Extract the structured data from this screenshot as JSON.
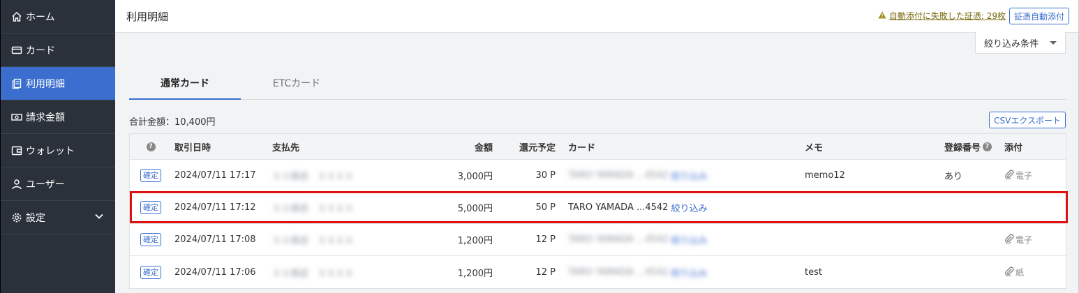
{
  "sidebar": {
    "items": [
      {
        "label": "ホーム",
        "icon": "home-icon"
      },
      {
        "label": "カード",
        "icon": "card-icon"
      },
      {
        "label": "利用明細",
        "icon": "statement-icon",
        "active": true
      },
      {
        "label": "請求金額",
        "icon": "money-icon"
      },
      {
        "label": "ウォレット",
        "icon": "wallet-icon"
      },
      {
        "label": "ユーザー",
        "icon": "user-icon"
      },
      {
        "label": "設定",
        "icon": "gear-icon"
      }
    ]
  },
  "header": {
    "title": "利用明細",
    "warning_link": "自動添付に失敗した証憑: 29枚",
    "auto_attach_label": "証憑自動添付"
  },
  "filter": {
    "label": "絞り込み条件"
  },
  "tabs": [
    {
      "label": "通常カード",
      "active": true
    },
    {
      "label": "ETCカード",
      "active": false
    }
  ],
  "summary": {
    "total": "合計金額：10,400円"
  },
  "csv_label": "CSVエクスポート",
  "table": {
    "headers": {
      "date": "取引日時",
      "payee": "支払先",
      "amount": "金額",
      "points": "還元予定",
      "card": "カード",
      "memo": "メモ",
      "reg": "登録番号",
      "attach": "添付"
    },
    "rows": [
      {
        "status": "確定",
        "date": "2024/07/11 17:17",
        "payee": "ＸＸ商店　ＸＸＸＸ",
        "amount": "3,000円",
        "points": "30 P",
        "card": "TARO YAMADA ...4542",
        "card_link": "絞り込み",
        "card_blurred": true,
        "memo": "memo12",
        "reg": "あり",
        "attach": "電子"
      },
      {
        "status": "確定",
        "date": "2024/07/11 17:12",
        "payee": "ＸＸ商店　ＸＸＸＸ",
        "amount": "5,000円",
        "points": "50 P",
        "card": "TARO YAMADA ...4542",
        "card_link": "絞り込み",
        "card_blurred": false,
        "memo": "",
        "reg": "",
        "attach": ""
      },
      {
        "status": "確定",
        "date": "2024/07/11 17:08",
        "payee": "ＸＸ商店　ＸＸＸＸ",
        "amount": "1,200円",
        "points": "12 P",
        "card": "TARO YAMADA ...4542",
        "card_link": "絞り込み",
        "card_blurred": true,
        "memo": "",
        "reg": "",
        "attach": "電子"
      },
      {
        "status": "確定",
        "date": "2024/07/11 17:06",
        "payee": "ＸＸ商店　ＸＸＸＸ",
        "amount": "1,200円",
        "points": "12 P",
        "card": "TARO YAMADA ...4542",
        "card_link": "絞り込み",
        "card_blurred": true,
        "memo": "test",
        "reg": "",
        "attach": "紙"
      }
    ]
  },
  "colors": {
    "accent": "#3b6ecf",
    "sidebar": "#2b313a",
    "highlight": "#e01010"
  }
}
